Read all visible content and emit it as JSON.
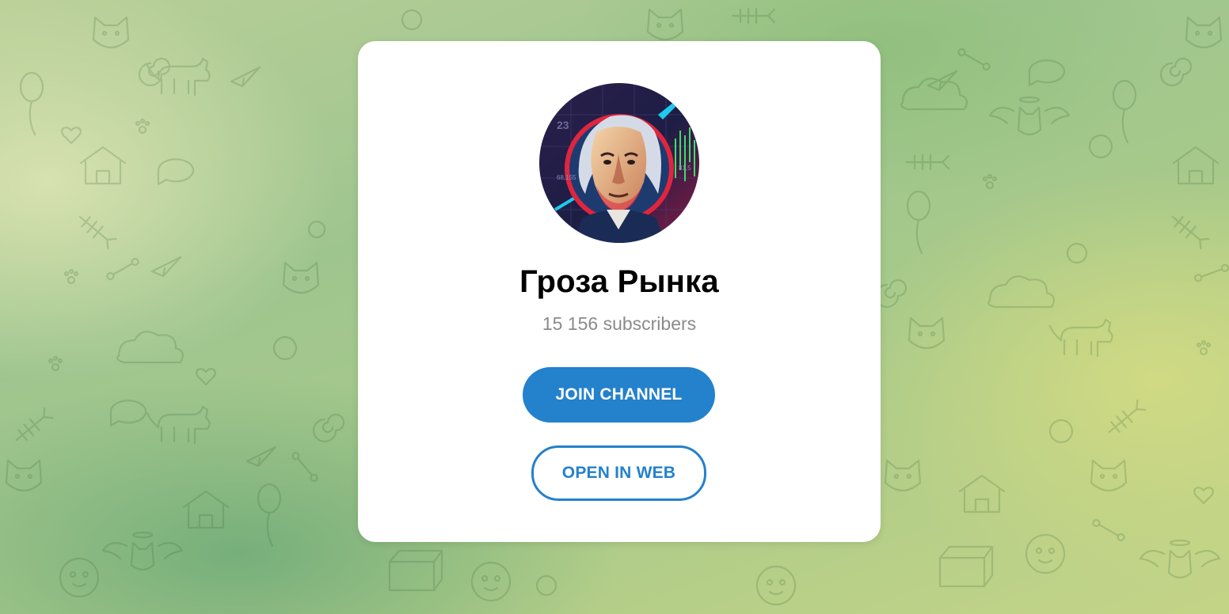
{
  "channel": {
    "title": "Гроза Рынка",
    "subscribers": "15 156 subscribers",
    "avatar_icon": "channel-avatar-portrait-icon"
  },
  "actions": {
    "join_label": "JOIN CHANNEL",
    "open_web_label": "OPEN IN WEB"
  },
  "colors": {
    "accent": "#2481cc",
    "card_bg": "#ffffff",
    "subtitle": "#8b8b8b"
  },
  "background": {
    "pattern_icon": "doodle-pattern-icon"
  }
}
